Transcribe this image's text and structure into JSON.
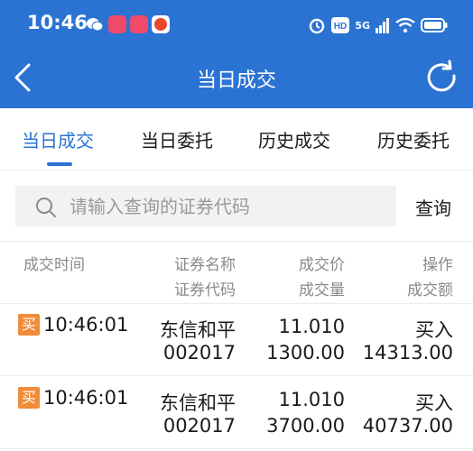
{
  "status_bar": {
    "time": "10:46",
    "network_label": "5G",
    "colors": {
      "wechat": "#07c160",
      "app_pink": "#f04a6a",
      "app_orange": "#e8472e"
    }
  },
  "header": {
    "title": "当日成交",
    "back_icon": "chevron-left-icon",
    "refresh_icon": "refresh-icon"
  },
  "tabs": [
    {
      "label": "当日成交",
      "active": true
    },
    {
      "label": "当日委托",
      "active": false
    },
    {
      "label": "历史成交",
      "active": false
    },
    {
      "label": "历史委托",
      "active": false
    }
  ],
  "search": {
    "placeholder": "请输入查询的证券代码",
    "value": "",
    "button_label": "查询"
  },
  "table": {
    "headers": {
      "time": "成交时间",
      "name": "证券名称",
      "code": "证券代码",
      "price": "成交价",
      "quantity": "成交量",
      "action": "操作",
      "amount": "成交额"
    },
    "rows": [
      {
        "badge": "买",
        "time": "10:46:01",
        "name": "东信和平",
        "code": "002017",
        "price": "11.010",
        "quantity": "1300.00",
        "action": "买入",
        "amount": "14313.00"
      },
      {
        "badge": "买",
        "time": "10:46:01",
        "name": "东信和平",
        "code": "002017",
        "price": "11.010",
        "quantity": "3700.00",
        "action": "买入",
        "amount": "40737.00"
      }
    ]
  },
  "colors": {
    "primary": "#2a73d3",
    "buy_badge": "#f08c3a"
  }
}
